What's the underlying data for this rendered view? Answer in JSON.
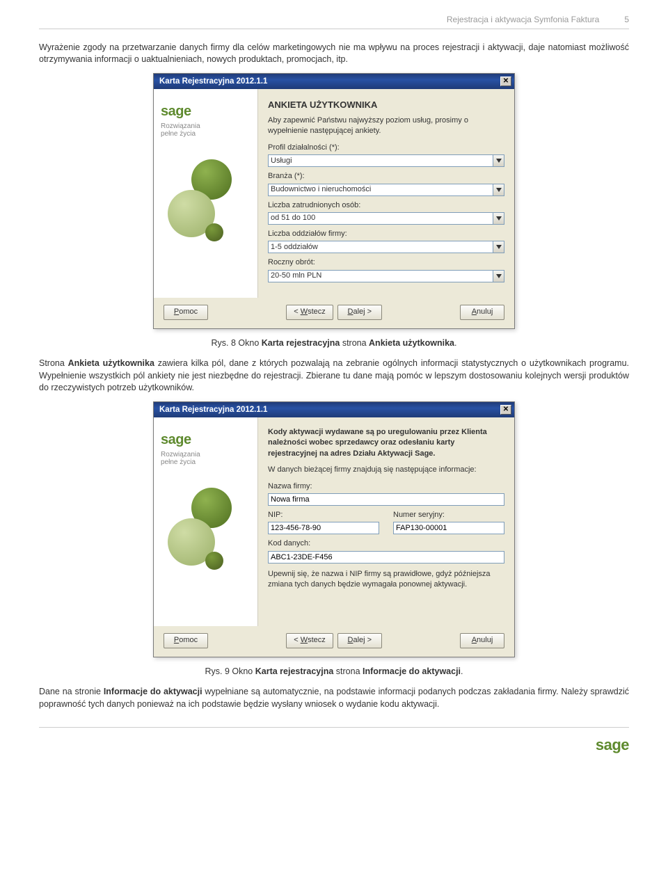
{
  "header": {
    "title": "Rejestracja i aktywacja Symfonia Faktura",
    "page": "5"
  },
  "paragraph1": "Wyrażenie zgody na przetwarzanie danych firmy dla celów marketingowych nie ma wpływu na proces rejestracji i aktywacji, daje natomiast możliwość otrzymywania informacji o uaktualnieniach, nowych produktach, promocjach, itp.",
  "caption1_prefix": "Rys. 8 Okno ",
  "caption1_b1": "Karta rejestracyjna",
  "caption1_mid": " strona ",
  "caption1_b2": "Ankieta użytkownika",
  "caption1_suffix": ".",
  "paragraph2_p1": "Strona ",
  "paragraph2_b": "Ankieta użytkownika",
  "paragraph2_p2": " zawiera kilka pól, dane z których pozwalają na zebranie ogólnych informacji statystycznych o użytkownikach programu. Wypełnienie wszystkich pól ankiety nie jest niezbędne do rejestracji. Zbierane tu dane mają pomóc w lepszym dostosowaniu kolejnych wersji produktów do rzeczywistych potrzeb użytkowników.",
  "caption2_prefix": "Rys. 9 Okno ",
  "caption2_b1": "Karta rejestracyjna",
  "caption2_mid": " strona ",
  "caption2_b2": "Informacje do aktywacji",
  "caption2_suffix": ".",
  "paragraph3_p1": "Dane na stronie ",
  "paragraph3_b": "Informacje do aktywacji",
  "paragraph3_p2": " wypełniane są automatycznie, na podstawie informacji podanych podczas zakładania firmy. Należy sprawdzić poprawność tych danych ponieważ na ich podstawie będzie wysłany wniosek o wydanie kodu aktywacji.",
  "sage": {
    "logo": "sage",
    "tagline1": "Rozwiązania",
    "tagline2": "pełne życia"
  },
  "buttons": {
    "help": "Pomoc",
    "back": "< Wstecz",
    "next": "Dalej >",
    "cancel": "Anuluj"
  },
  "dialog1": {
    "title": "Karta Rejestracyjna 2012.1.1",
    "heading": "ANKIETA UŻYTKOWNIKA",
    "intro": "Aby zapewnić Państwu najwyższy poziom usług, prosimy o wypełnienie następującej ankiety.",
    "fields": {
      "profile": {
        "label": "Profil działalności (*):",
        "value": "Usługi"
      },
      "industry": {
        "label": "Branża (*):",
        "value": "Budownictwo i nieruchomości"
      },
      "employees": {
        "label": "Liczba zatrudnionych osób:",
        "value": "od 51 do 100"
      },
      "branches": {
        "label": "Liczba oddziałów firmy:",
        "value": "1-5 oddziałów"
      },
      "turnover": {
        "label": "Roczny obrót:",
        "value": "20-50 mln PLN"
      }
    }
  },
  "dialog2": {
    "title": "Karta Rejestracyjna 2012.1.1",
    "intro": "Kody aktywacji wydawane są po uregulowaniu przez Klienta należności wobec sprzedawcy oraz odesłaniu karty rejestracyjnej na adres Działu Aktywacji Sage.",
    "subintro": "W danych bieżącej firmy znajdują się następujące informacje:",
    "fields": {
      "company": {
        "label": "Nazwa firmy:",
        "value": "Nowa firma"
      },
      "nip": {
        "label": "NIP:",
        "value": "123-456-78-90"
      },
      "serial": {
        "label": "Numer seryjny:",
        "value": "FAP130-00001"
      },
      "datacode": {
        "label": "Kod danych:",
        "value": "ABC1-23DE-F456"
      }
    },
    "note": "Upewnij się, że nazwa i NIP firmy są prawidłowe, gdyż późniejsza zmiana tych danych będzie wymagała ponownej aktywacji."
  }
}
